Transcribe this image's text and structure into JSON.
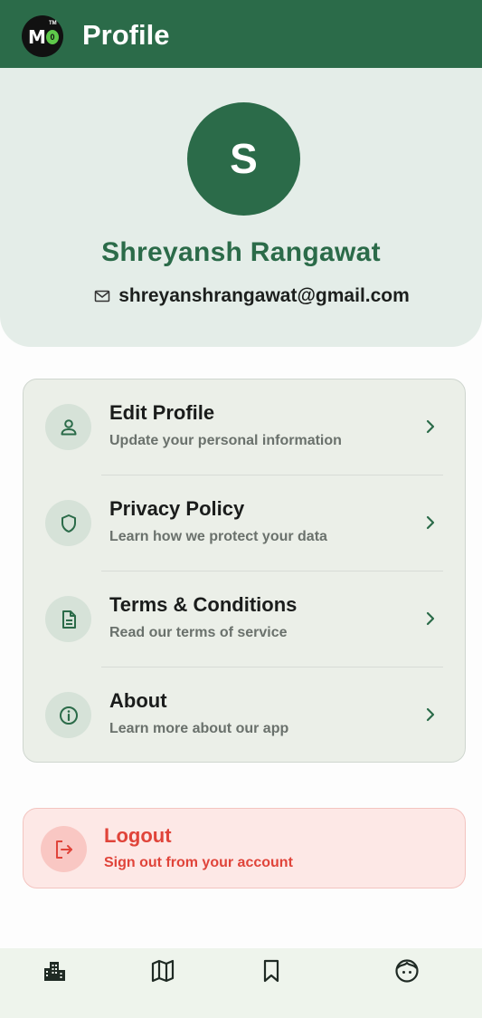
{
  "appbar": {
    "logo_letter": "M",
    "logo_badge": "0",
    "logo_tm": "TM",
    "title": "Profile"
  },
  "profile": {
    "avatar_initial": "S",
    "name": "Shreyansh Rangawat",
    "email": "shreyanshrangawat@gmail.com"
  },
  "menu": {
    "items": [
      {
        "title": "Edit Profile",
        "subtitle": "Update your personal information",
        "icon": "person-icon"
      },
      {
        "title": "Privacy Policy",
        "subtitle": "Learn how we protect your data",
        "icon": "shield-icon"
      },
      {
        "title": "Terms & Conditions",
        "subtitle": "Read our terms of service",
        "icon": "document-icon"
      },
      {
        "title": "About",
        "subtitle": "Learn more about our app",
        "icon": "info-icon"
      }
    ]
  },
  "logout": {
    "title": "Logout",
    "subtitle": "Sign out from your account",
    "icon": "logout-icon"
  },
  "bottom_nav": {
    "items": [
      {
        "icon": "buildings-icon"
      },
      {
        "icon": "map-icon"
      },
      {
        "icon": "bookmark-icon"
      },
      {
        "icon": "face-icon",
        "active": true
      }
    ]
  },
  "colors": {
    "primary": "#2b6b49",
    "header_bg": "#e4ede8",
    "card_bg": "#ebefe8",
    "danger": "#e0443a",
    "danger_bg": "#fde8e6"
  }
}
